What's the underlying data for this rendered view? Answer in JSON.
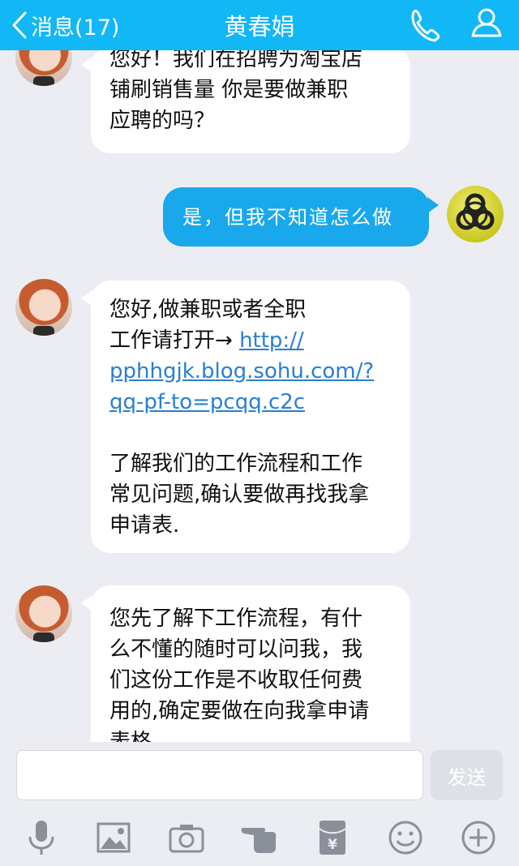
{
  "header": {
    "back_label": "消息(17)",
    "title": "黄春娟",
    "background": "#12b7f5"
  },
  "messages": [
    {
      "side": "left",
      "lines": [
        "您好！我们在招聘为淘宝店",
        "铺刷销售量 你是要做兼职",
        "应聘的吗？"
      ]
    },
    {
      "side": "right",
      "text": "是，但我不知道怎么做"
    },
    {
      "side": "left",
      "lines": [
        "您好,做兼职或者全职",
        "工作请打开→ "
      ],
      "link_lines": [
        "http://",
        "pphhgjk.blog.sohu.com/?",
        "qq-pf-to=pcqq.c2c"
      ],
      "lines_after": [
        "了解我们的工作流程和工作",
        "常见问题,确认要做再找我拿",
        "申请表."
      ]
    },
    {
      "side": "left",
      "lines": [
        "您先了解下工作流程，有什",
        "么不懂的随时可以问我，我",
        "们这份工作是不收取任何费",
        "用的,确定要做在向我拿申请",
        "表格"
      ]
    }
  ],
  "input": {
    "value": "",
    "send_label": "发送"
  },
  "toolbar": {
    "icons": [
      "microphone-icon",
      "image-icon",
      "camera-icon",
      "poke-icon",
      "red-packet-icon",
      "emoji-icon",
      "plus-icon"
    ]
  },
  "colors": {
    "accent": "#12b7f5",
    "my_bubble": "#1aa8ec",
    "link": "#2a7fd0",
    "chat_background": "#ebedf2"
  }
}
